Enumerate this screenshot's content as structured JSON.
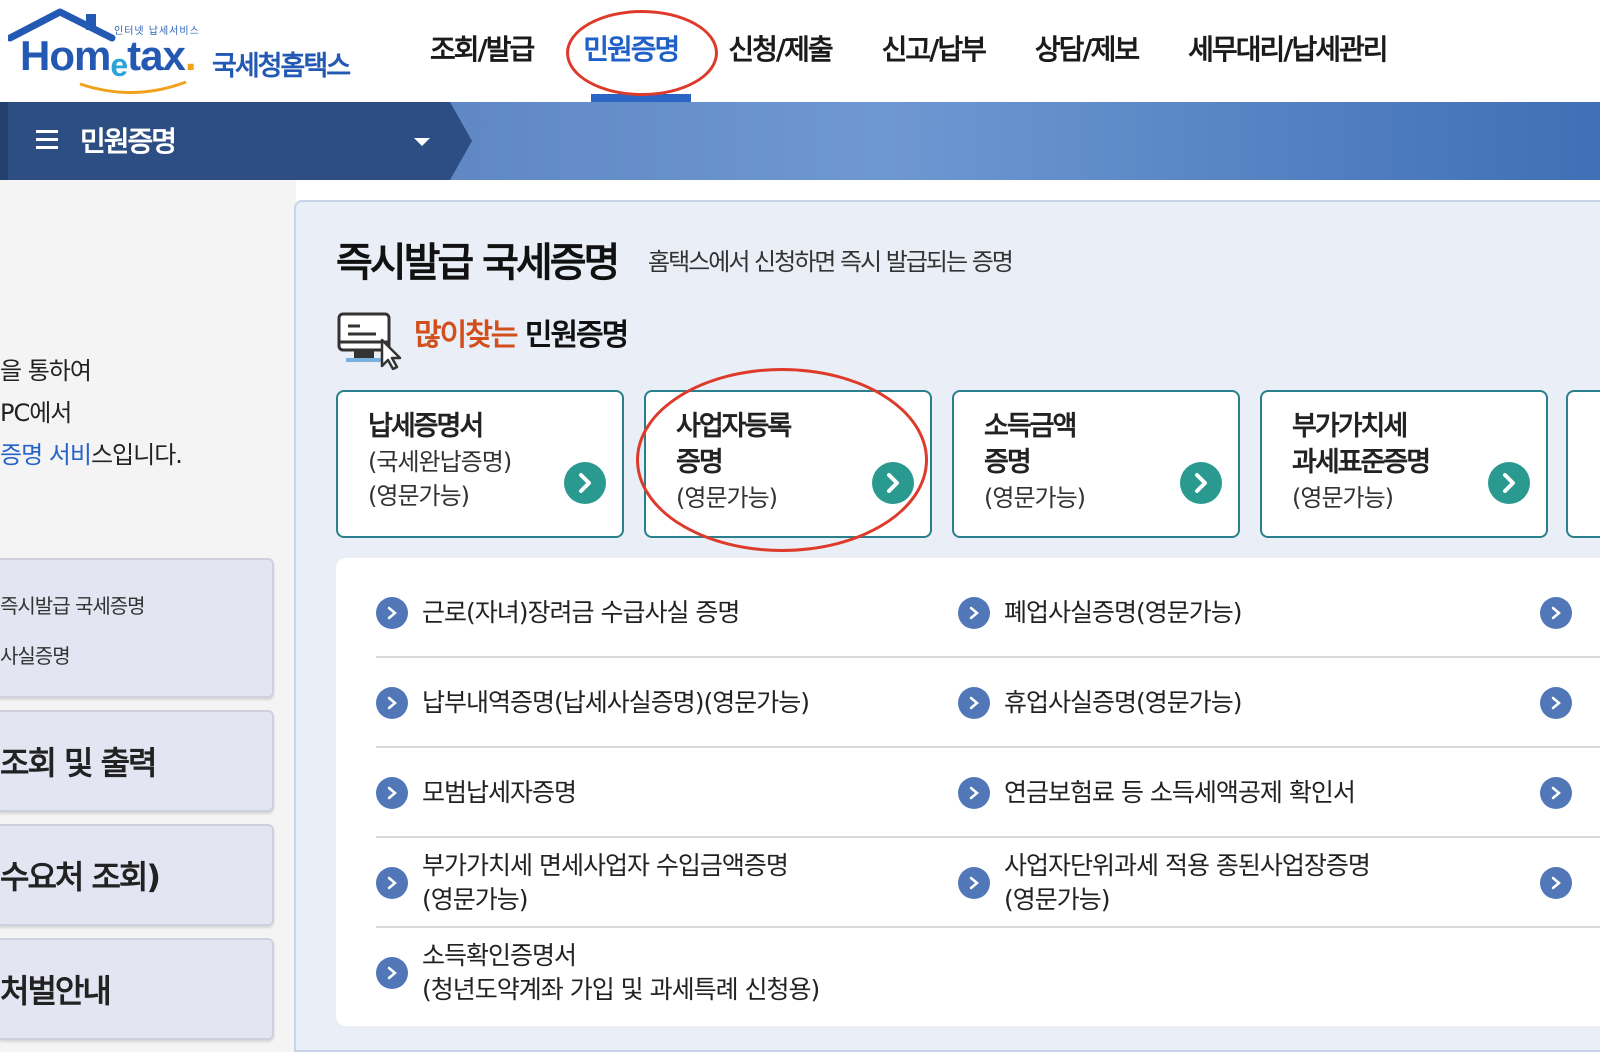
{
  "header": {
    "logo": {
      "tagline": "인터넷 납세서비스",
      "word_pre": "Hom",
      "word_e": "e",
      "word_post": "tax",
      "word_dot": ".",
      "korean": "국세청홈택스"
    },
    "nav": [
      {
        "label": "조회/발급",
        "active": false
      },
      {
        "label": "민원증명",
        "active": true
      },
      {
        "label": "신청/제출",
        "active": false
      },
      {
        "label": "신고/납부",
        "active": false
      },
      {
        "label": "상담/제보",
        "active": false
      },
      {
        "label": "세무대리/납세관리",
        "active": false
      }
    ]
  },
  "subbar": {
    "title": "민원증명",
    "menu_icon": "hamburger-icon",
    "caret_icon": "caret-down-icon"
  },
  "left_panel": {
    "desc_lines": [
      "을 통하여",
      " PC에서"
    ],
    "desc_line3_blue": "증명 서비",
    "desc_line3_rest": "스입니다.",
    "box1_lines": [
      "즉시발급 국세증명",
      "사실증명"
    ],
    "box2": "조회 및 출력",
    "box3": "수요처 조회)",
    "box4": "처벌안내"
  },
  "main": {
    "title": "즉시발급 국세증명",
    "subtitle": "홈택스에서 신청하면 즉시 발급되는 증명",
    "popular_highlight": "많이찾는",
    "popular_rest": " 민원증명",
    "popular_icon": "monitor-cursor-icon",
    "cards": [
      {
        "t1": "납세증명서",
        "s1": "(국세완납증명)",
        "s2": "(영문가능)"
      },
      {
        "t1": "사업자등록",
        "t2": "증명",
        "s2": "(영문가능)"
      },
      {
        "t1": "소득금액",
        "t2": "증명",
        "s2": "(영문가능)"
      },
      {
        "t1": "부가가치세",
        "t2": "과세표준증명",
        "s2": "(영문가능)"
      }
    ],
    "list": [
      {
        "left": [
          "근로(자녀)장려금 수급사실 증명"
        ],
        "right": [
          "폐업사실증명(영문가능)"
        ]
      },
      {
        "left": [
          "납부내역증명(납세사실증명)(영문가능)"
        ],
        "right": [
          "휴업사실증명(영문가능)"
        ]
      },
      {
        "left": [
          "모범납세자증명"
        ],
        "right": [
          "연금보험료 등 소득세액공제 확인서"
        ]
      },
      {
        "left": [
          "부가가치세 면세사업자 수입금액증명",
          "(영문가능)"
        ],
        "right": [
          "사업자단위과세 적용 종된사업장증명",
          "(영문가능)"
        ]
      },
      {
        "left": [
          "소득확인증명서",
          "(청년도약계좌 가입 및 과세특례 신청용)"
        ],
        "right": []
      }
    ]
  },
  "colors": {
    "brand_blue": "#2459b3",
    "nav_active": "#1f61c8",
    "annotation_red": "#dd3a2a",
    "card_teal": "#2a9990",
    "popular_orange": "#d24e1b"
  }
}
